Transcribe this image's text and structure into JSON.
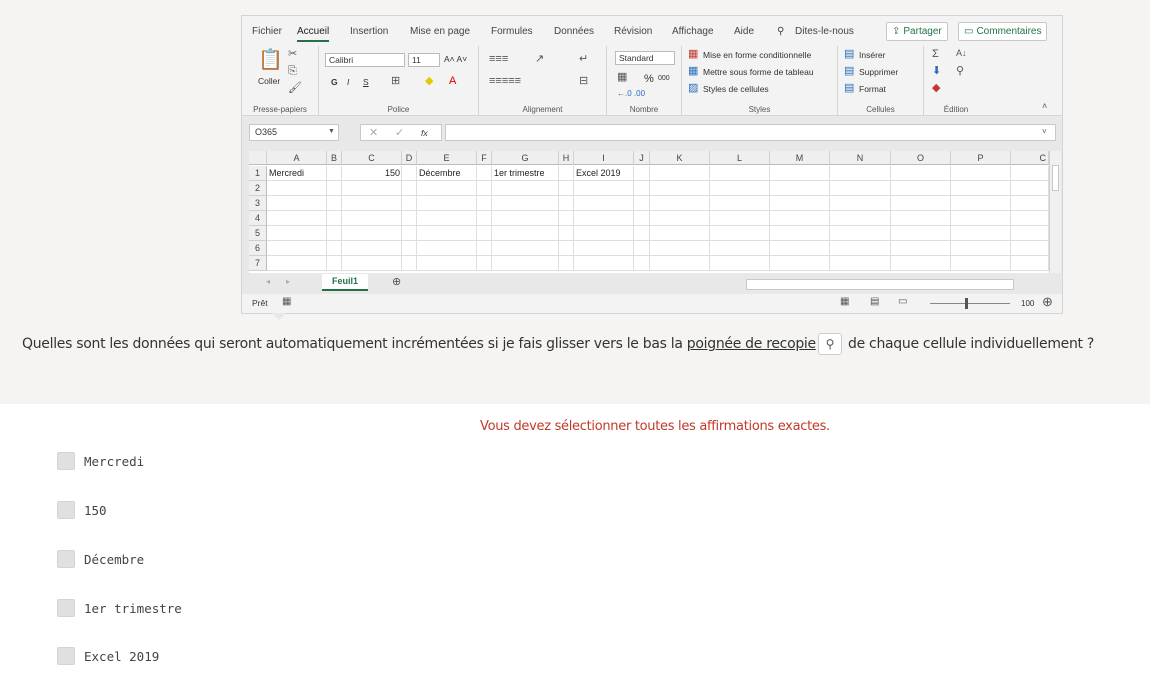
{
  "excel": {
    "menu": [
      "Fichier",
      "Accueil",
      "Insertion",
      "Mise en page",
      "Formules",
      "Données",
      "Révision",
      "Affichage",
      "Aide",
      "Dites-le-nous"
    ],
    "active_menu": "Accueil",
    "share_label": "Partager",
    "comments_label": "Commentaires",
    "ribbon": {
      "coller": "Coller",
      "font_name": "Calibri",
      "font_size": "11",
      "bold": "G",
      "italic": "I",
      "underline": "S",
      "number_format": "Standard",
      "percent": "%",
      "thousands": "000",
      "cond_format": "Mise en forme conditionnelle",
      "table_format": "Mettre sous forme de tableau",
      "cell_styles": "Styles de cellules",
      "insert": "Insérer",
      "delete": "Supprimer",
      "format": "Format",
      "groups": {
        "clipboard": "Presse-papiers",
        "font": "Police",
        "alignment": "Alignement",
        "number": "Nombre",
        "styles": "Styles",
        "cells": "Cellules",
        "editing": "Édition"
      }
    },
    "name_box": "O365",
    "fx_label": "fx",
    "columns": [
      "A",
      "B",
      "C",
      "D",
      "E",
      "F",
      "G",
      "H",
      "I",
      "J",
      "K",
      "L",
      "M",
      "N",
      "O",
      "P",
      "C"
    ],
    "rows": [
      "1",
      "2",
      "3",
      "4",
      "5",
      "6",
      "7"
    ],
    "row1": {
      "A": "Mercredi",
      "C": "150",
      "E": "Décembre",
      "G": "1er trimestre",
      "I": "Excel 2019"
    },
    "sheet_tab": "Feuil1",
    "status_ready": "Prêt",
    "zoom": "100"
  },
  "question": {
    "before": "Quelles sont les données qui seront automatiquement incrémentées si je fais glisser vers le bas la ",
    "link": "poignée de recopie",
    "after": " de chaque cellule individuellement ?"
  },
  "instruction": "Vous devez sélectionner toutes les affirmations exactes.",
  "options": [
    "Mercredi",
    "150",
    "Décembre",
    "1er trimestre",
    "Excel 2019"
  ],
  "colors": {
    "excel_green": "#217346",
    "instruction_red": "#c0392b",
    "background_top": "#f5f4f2"
  }
}
